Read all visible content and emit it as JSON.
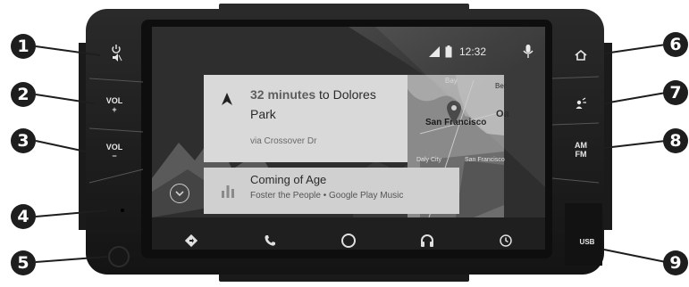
{
  "markers": [
    "1",
    "2",
    "3",
    "4",
    "5",
    "6",
    "7",
    "8",
    "9"
  ],
  "buttons": {
    "vol_up": {
      "label": "VOL",
      "sign": "+"
    },
    "vol_down": {
      "label": "VOL",
      "sign": "−"
    },
    "am_fm": {
      "line1": "AM",
      "line2": "FM"
    },
    "usb": "USB"
  },
  "status": {
    "time": "12:32"
  },
  "navigation_card": {
    "duration": "32 minutes",
    "destination_prefix": " to Dolores",
    "destination_line2": "Park",
    "route": "via Crossover Dr"
  },
  "map_labels": {
    "city": "San Francisco",
    "bay": "Bay",
    "oa": "Oa",
    "ber": "Ber",
    "daly": "Daly City",
    "sfo": "San Francisco"
  },
  "media_card": {
    "title": "Coming of Age",
    "subtitle": "Foster the People • Google Play Music"
  },
  "icons": {
    "power_mute": "power-mute-icon",
    "home": "home-icon",
    "voice": "voice-icon",
    "signal": "signal-icon",
    "battery": "battery-icon",
    "microphone": "microphone-icon",
    "navigation": "navigation-icon",
    "phone": "phone-icon",
    "home_circle": "home-circle-icon",
    "headphones": "headphones-icon",
    "recent": "recent-icon",
    "expand": "chevron-down-icon",
    "equalizer": "equalizer-icon"
  }
}
